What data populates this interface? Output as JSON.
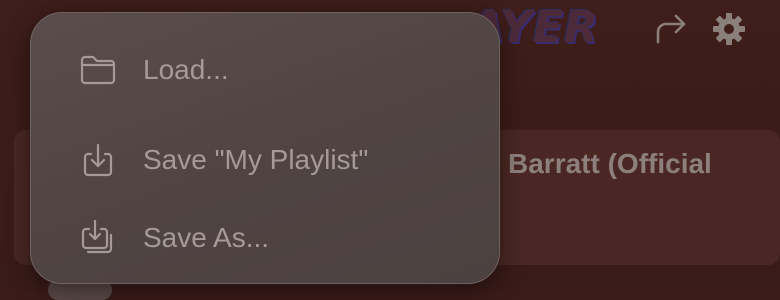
{
  "app": {
    "logo_text": "AYER",
    "header_icons": [
      "share-icon",
      "gear-icon"
    ]
  },
  "player": {
    "track_title": "Barratt (Official"
  },
  "menu": {
    "items": [
      {
        "label": "Load...",
        "icon": "folder-icon"
      },
      {
        "label": "Save \"My Playlist\"",
        "icon": "save-icon"
      },
      {
        "label": "Save As...",
        "icon": "save-as-icon"
      }
    ]
  },
  "colors": {
    "background": "#3a1b19",
    "menu_bg": "#544846",
    "menu_text": "#a59a97",
    "icon": "#a59a97"
  }
}
